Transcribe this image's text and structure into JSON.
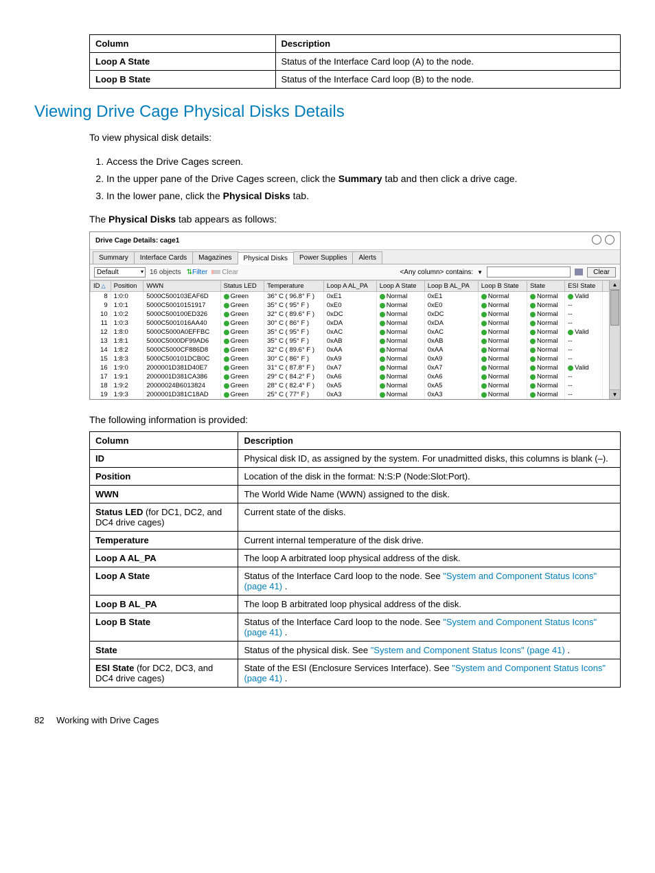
{
  "top_table": {
    "header": [
      "Column",
      "Description"
    ],
    "rows": [
      [
        "Loop A State",
        "Status of the Interface Card loop (A) to the node."
      ],
      [
        "Loop B State",
        "Status of the Interface Card loop (B) to the node."
      ]
    ]
  },
  "heading": "Viewing Drive Cage Physical Disks Details",
  "intro": "To view physical disk details:",
  "steps": [
    {
      "pre": "Access the Drive Cages screen.",
      "bold": "",
      "post": ""
    },
    {
      "pre": "In the upper pane of the Drive Cages screen, click the ",
      "bold": "Summary",
      "post": " tab and then click a drive cage."
    },
    {
      "pre": "In the lower pane, click the ",
      "bold": "Physical Disks",
      "post": " tab."
    }
  ],
  "tab_line_pre": "The ",
  "tab_line_bold": "Physical Disks",
  "tab_line_post": " tab appears as follows:",
  "ui": {
    "title": "Drive Cage Details: cage1",
    "tabs": [
      "Summary",
      "Interface Cards",
      "Magazines",
      "Physical Disks",
      "Power Supplies",
      "Alerts"
    ],
    "default": "Default",
    "count": "16 objects",
    "filter": "Filter",
    "clear": "Clear",
    "where": "<Any column> contains:",
    "clearbtn": "Clear",
    "cols": [
      "ID",
      "Position",
      "WWN",
      "Status LED",
      "Temperature",
      "Loop A AL_PA",
      "Loop A State",
      "Loop B AL_PA",
      "Loop B State",
      "State",
      "ESI State",
      ""
    ],
    "rows": [
      {
        "id": "8",
        "pos": "1:0:0",
        "wwn": "5000C500103EAF6D",
        "led": "Green",
        "t": "36° C ( 96.8° F )",
        "la": "0xE1",
        "las": "Normal",
        "lb": "0xE1",
        "lbs": "Normal",
        "st": "Normal",
        "esi": "Valid"
      },
      {
        "id": "9",
        "pos": "1:0:1",
        "wwn": "5000C50010151917",
        "led": "Green",
        "t": "35° C ( 95° F )",
        "la": "0xE0",
        "las": "Normal",
        "lb": "0xE0",
        "lbs": "Normal",
        "st": "Normal",
        "esi": "--"
      },
      {
        "id": "10",
        "pos": "1:0:2",
        "wwn": "5000C500100ED326",
        "led": "Green",
        "t": "32° C ( 89.6° F )",
        "la": "0xDC",
        "las": "Normal",
        "lb": "0xDC",
        "lbs": "Normal",
        "st": "Normal",
        "esi": "--"
      },
      {
        "id": "11",
        "pos": "1:0:3",
        "wwn": "5000C5001016AA40",
        "led": "Green",
        "t": "30° C ( 86° F )",
        "la": "0xDA",
        "las": "Normal",
        "lb": "0xDA",
        "lbs": "Normal",
        "st": "Normal",
        "esi": "--"
      },
      {
        "id": "12",
        "pos": "1:8:0",
        "wwn": "5000C5000A0EFFBC",
        "led": "Green",
        "t": "35° C ( 95° F )",
        "la": "0xAC",
        "las": "Normal",
        "lb": "0xAC",
        "lbs": "Normal",
        "st": "Normal",
        "esi": "Valid"
      },
      {
        "id": "13",
        "pos": "1:8:1",
        "wwn": "5000C5000DF99AD6",
        "led": "Green",
        "t": "35° C ( 95° F )",
        "la": "0xAB",
        "las": "Normal",
        "lb": "0xAB",
        "lbs": "Normal",
        "st": "Normal",
        "esi": "--"
      },
      {
        "id": "14",
        "pos": "1:8:2",
        "wwn": "5000C5000CF886D8",
        "led": "Green",
        "t": "32° C ( 89.6° F )",
        "la": "0xAA",
        "las": "Normal",
        "lb": "0xAA",
        "lbs": "Normal",
        "st": "Normal",
        "esi": "--"
      },
      {
        "id": "15",
        "pos": "1:8:3",
        "wwn": "5000C500101DCB0C",
        "led": "Green",
        "t": "30° C ( 86° F )",
        "la": "0xA9",
        "las": "Normal",
        "lb": "0xA9",
        "lbs": "Normal",
        "st": "Normal",
        "esi": "--"
      },
      {
        "id": "16",
        "pos": "1:9:0",
        "wwn": "2000001D381D40E7",
        "led": "Green",
        "t": "31° C ( 87.8° F )",
        "la": "0xA7",
        "las": "Normal",
        "lb": "0xA7",
        "lbs": "Normal",
        "st": "Normal",
        "esi": "Valid"
      },
      {
        "id": "17",
        "pos": "1:9:1",
        "wwn": "2000001D381CA386",
        "led": "Green",
        "t": "29° C ( 84.2° F )",
        "la": "0xA6",
        "las": "Normal",
        "lb": "0xA6",
        "lbs": "Normal",
        "st": "Normal",
        "esi": "--"
      },
      {
        "id": "18",
        "pos": "1:9:2",
        "wwn": "20000024B6013824",
        "led": "Green",
        "t": "28° C ( 82.4° F )",
        "la": "0xA5",
        "las": "Normal",
        "lb": "0xA5",
        "lbs": "Normal",
        "st": "Normal",
        "esi": "--"
      },
      {
        "id": "19",
        "pos": "1:9:3",
        "wwn": "2000001D381C18AD",
        "led": "Green",
        "t": "25° C ( 77° F )",
        "la": "0xA3",
        "las": "Normal",
        "lb": "0xA3",
        "lbs": "Normal",
        "st": "Normal",
        "esi": "--"
      }
    ]
  },
  "after_panel": "The following information is provided:",
  "info_table": {
    "header": [
      "Column",
      "Description"
    ],
    "rows": [
      {
        "col": "ID",
        "desc": "Physical disk ID, as assigned by the system. For unadmitted disks, this columns is blank (–).",
        "link": ""
      },
      {
        "col": "Position",
        "desc": "Location of the disk in the format: N:S:P (Node:Slot:Port).",
        "link": ""
      },
      {
        "col": "WWN",
        "desc": "The World Wide Name (WWN) assigned to the disk.",
        "link": ""
      },
      {
        "col_html": "<b>Status LED</b> (for DC1, DC2, and DC4 drive cages)",
        "desc": "Current state of the disks.",
        "link": ""
      },
      {
        "col": "Temperature",
        "desc": "Current internal temperature of the disk drive.",
        "link": ""
      },
      {
        "col": "Loop A AL_PA",
        "desc": "The loop A arbitrated loop physical address of the disk.",
        "link": ""
      },
      {
        "col": "Loop A State",
        "desc": "Status of the Interface Card loop to the node. See ",
        "link": "\"System and Component Status Icons\" (page 41)",
        "post": " ."
      },
      {
        "col": "Loop B AL_PA",
        "desc": "The loop B arbitrated loop physical address of the disk.",
        "link": ""
      },
      {
        "col": "Loop B State",
        "desc": "Status of the Interface Card loop to the node. See ",
        "link": "\"System and Component Status Icons\" (page 41)",
        "post": " ."
      },
      {
        "col": "State",
        "desc": "Status of the physical disk. See ",
        "link": "\"System and Component Status Icons\" (page 41)",
        "post": " ."
      },
      {
        "col_html": "<b>ESI State</b> (for DC2, DC3, and DC4 drive cages)",
        "desc": "State of the ESI (Enclosure Services Interface). See ",
        "link": "\"System and Component Status Icons\" (page 41)",
        "post": " ."
      }
    ]
  },
  "footer": {
    "page": "82",
    "text": "Working with Drive Cages"
  }
}
